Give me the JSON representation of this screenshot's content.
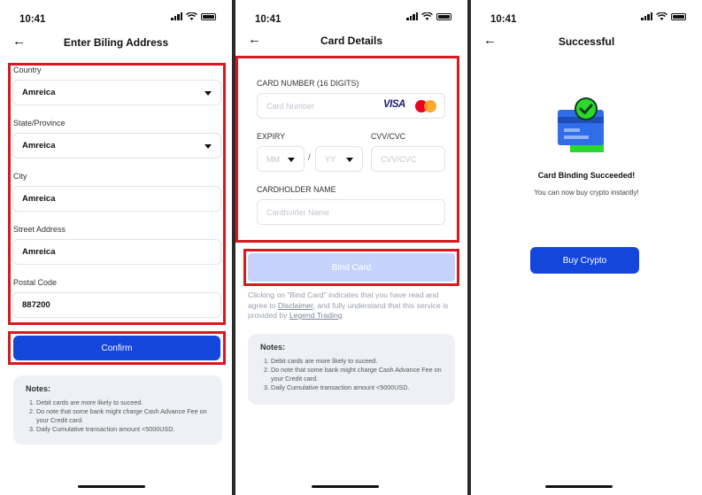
{
  "status": {
    "time": "10:41"
  },
  "screen1": {
    "title": "Enter Biling Address",
    "fields": [
      {
        "label": "Country",
        "value": "Amreica"
      },
      {
        "label": "State/Province",
        "value": "Amreica"
      },
      {
        "label": "City",
        "value": "Amreica"
      },
      {
        "label": "Street Address",
        "value": "Amreica"
      },
      {
        "label": "Postal Code",
        "value": "887200"
      }
    ],
    "confirm_label": "Confirm",
    "notes": {
      "heading": "Notes:",
      "items": [
        "Debit cards are more likely to suceed.",
        "Do note that some bank might charge Cash Advance Fee on your Credit card.",
        "Daily Cumulative transaction amount <5000USD."
      ]
    }
  },
  "screen2": {
    "title": "Card Details",
    "card_number_label": "CARD NUMBER (16 DIGITS)",
    "card_number_placeholder": "Card Number",
    "visa_text": "VISA",
    "expiry_label": "EXPIRY",
    "month_placeholder": "MM",
    "year_placeholder": "YY",
    "slash": "/",
    "cvv_label": "CVV/CVC",
    "cvv_placeholder": "CVV/CVC",
    "cardholder_label": "CARDHOLDER NAME",
    "cardholder_placeholder": "Cardholder Name",
    "bind_label": "Bind Card",
    "legal": {
      "part1": "Clicking on \"Bind Card\" indicates that you have read and agree to ",
      "disclaimer": "Disclaimer",
      "part2": ", and fully understand that this service is provided by ",
      "provider": "Legend Trading",
      "part3": "."
    },
    "notes": {
      "heading": "Notes:",
      "items": [
        "Debit cards are more likely to suceed.",
        "Do note that some bank might charge Cash Advance Fee on your Credit card.",
        "Daily Cumulative transaction amount <5000USD."
      ]
    }
  },
  "screen3": {
    "title": "Successful",
    "heading": "Card Binding Succeeded!",
    "subtext": "You can now buy crypto instantly!",
    "buy_label": "Buy Crypto"
  },
  "colors": {
    "primary": "#1446dc",
    "highlight": "#d71920",
    "disabled": "#c5d3fb",
    "success": "#2bd92b"
  }
}
